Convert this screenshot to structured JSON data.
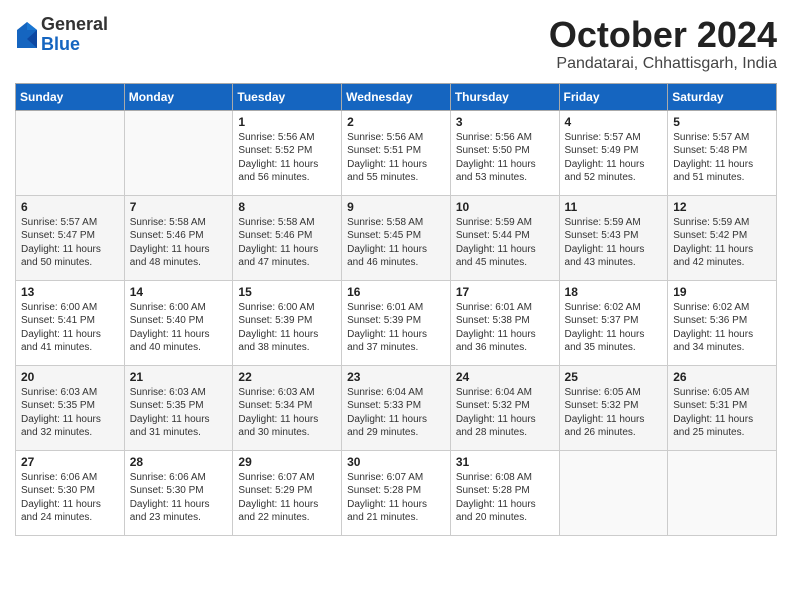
{
  "logo": {
    "general": "General",
    "blue": "Blue"
  },
  "title": "October 2024",
  "location": "Pandatarai, Chhattisgarh, India",
  "days_of_week": [
    "Sunday",
    "Monday",
    "Tuesday",
    "Wednesday",
    "Thursday",
    "Friday",
    "Saturday"
  ],
  "weeks": [
    [
      {
        "day": "",
        "content": ""
      },
      {
        "day": "",
        "content": ""
      },
      {
        "day": "1",
        "content": "Sunrise: 5:56 AM\nSunset: 5:52 PM\nDaylight: 11 hours and 56 minutes."
      },
      {
        "day": "2",
        "content": "Sunrise: 5:56 AM\nSunset: 5:51 PM\nDaylight: 11 hours and 55 minutes."
      },
      {
        "day": "3",
        "content": "Sunrise: 5:56 AM\nSunset: 5:50 PM\nDaylight: 11 hours and 53 minutes."
      },
      {
        "day": "4",
        "content": "Sunrise: 5:57 AM\nSunset: 5:49 PM\nDaylight: 11 hours and 52 minutes."
      },
      {
        "day": "5",
        "content": "Sunrise: 5:57 AM\nSunset: 5:48 PM\nDaylight: 11 hours and 51 minutes."
      }
    ],
    [
      {
        "day": "6",
        "content": "Sunrise: 5:57 AM\nSunset: 5:47 PM\nDaylight: 11 hours and 50 minutes."
      },
      {
        "day": "7",
        "content": "Sunrise: 5:58 AM\nSunset: 5:46 PM\nDaylight: 11 hours and 48 minutes."
      },
      {
        "day": "8",
        "content": "Sunrise: 5:58 AM\nSunset: 5:46 PM\nDaylight: 11 hours and 47 minutes."
      },
      {
        "day": "9",
        "content": "Sunrise: 5:58 AM\nSunset: 5:45 PM\nDaylight: 11 hours and 46 minutes."
      },
      {
        "day": "10",
        "content": "Sunrise: 5:59 AM\nSunset: 5:44 PM\nDaylight: 11 hours and 45 minutes."
      },
      {
        "day": "11",
        "content": "Sunrise: 5:59 AM\nSunset: 5:43 PM\nDaylight: 11 hours and 43 minutes."
      },
      {
        "day": "12",
        "content": "Sunrise: 5:59 AM\nSunset: 5:42 PM\nDaylight: 11 hours and 42 minutes."
      }
    ],
    [
      {
        "day": "13",
        "content": "Sunrise: 6:00 AM\nSunset: 5:41 PM\nDaylight: 11 hours and 41 minutes."
      },
      {
        "day": "14",
        "content": "Sunrise: 6:00 AM\nSunset: 5:40 PM\nDaylight: 11 hours and 40 minutes."
      },
      {
        "day": "15",
        "content": "Sunrise: 6:00 AM\nSunset: 5:39 PM\nDaylight: 11 hours and 38 minutes."
      },
      {
        "day": "16",
        "content": "Sunrise: 6:01 AM\nSunset: 5:39 PM\nDaylight: 11 hours and 37 minutes."
      },
      {
        "day": "17",
        "content": "Sunrise: 6:01 AM\nSunset: 5:38 PM\nDaylight: 11 hours and 36 minutes."
      },
      {
        "day": "18",
        "content": "Sunrise: 6:02 AM\nSunset: 5:37 PM\nDaylight: 11 hours and 35 minutes."
      },
      {
        "day": "19",
        "content": "Sunrise: 6:02 AM\nSunset: 5:36 PM\nDaylight: 11 hours and 34 minutes."
      }
    ],
    [
      {
        "day": "20",
        "content": "Sunrise: 6:03 AM\nSunset: 5:35 PM\nDaylight: 11 hours and 32 minutes."
      },
      {
        "day": "21",
        "content": "Sunrise: 6:03 AM\nSunset: 5:35 PM\nDaylight: 11 hours and 31 minutes."
      },
      {
        "day": "22",
        "content": "Sunrise: 6:03 AM\nSunset: 5:34 PM\nDaylight: 11 hours and 30 minutes."
      },
      {
        "day": "23",
        "content": "Sunrise: 6:04 AM\nSunset: 5:33 PM\nDaylight: 11 hours and 29 minutes."
      },
      {
        "day": "24",
        "content": "Sunrise: 6:04 AM\nSunset: 5:32 PM\nDaylight: 11 hours and 28 minutes."
      },
      {
        "day": "25",
        "content": "Sunrise: 6:05 AM\nSunset: 5:32 PM\nDaylight: 11 hours and 26 minutes."
      },
      {
        "day": "26",
        "content": "Sunrise: 6:05 AM\nSunset: 5:31 PM\nDaylight: 11 hours and 25 minutes."
      }
    ],
    [
      {
        "day": "27",
        "content": "Sunrise: 6:06 AM\nSunset: 5:30 PM\nDaylight: 11 hours and 24 minutes."
      },
      {
        "day": "28",
        "content": "Sunrise: 6:06 AM\nSunset: 5:30 PM\nDaylight: 11 hours and 23 minutes."
      },
      {
        "day": "29",
        "content": "Sunrise: 6:07 AM\nSunset: 5:29 PM\nDaylight: 11 hours and 22 minutes."
      },
      {
        "day": "30",
        "content": "Sunrise: 6:07 AM\nSunset: 5:28 PM\nDaylight: 11 hours and 21 minutes."
      },
      {
        "day": "31",
        "content": "Sunrise: 6:08 AM\nSunset: 5:28 PM\nDaylight: 11 hours and 20 minutes."
      },
      {
        "day": "",
        "content": ""
      },
      {
        "day": "",
        "content": ""
      }
    ]
  ]
}
